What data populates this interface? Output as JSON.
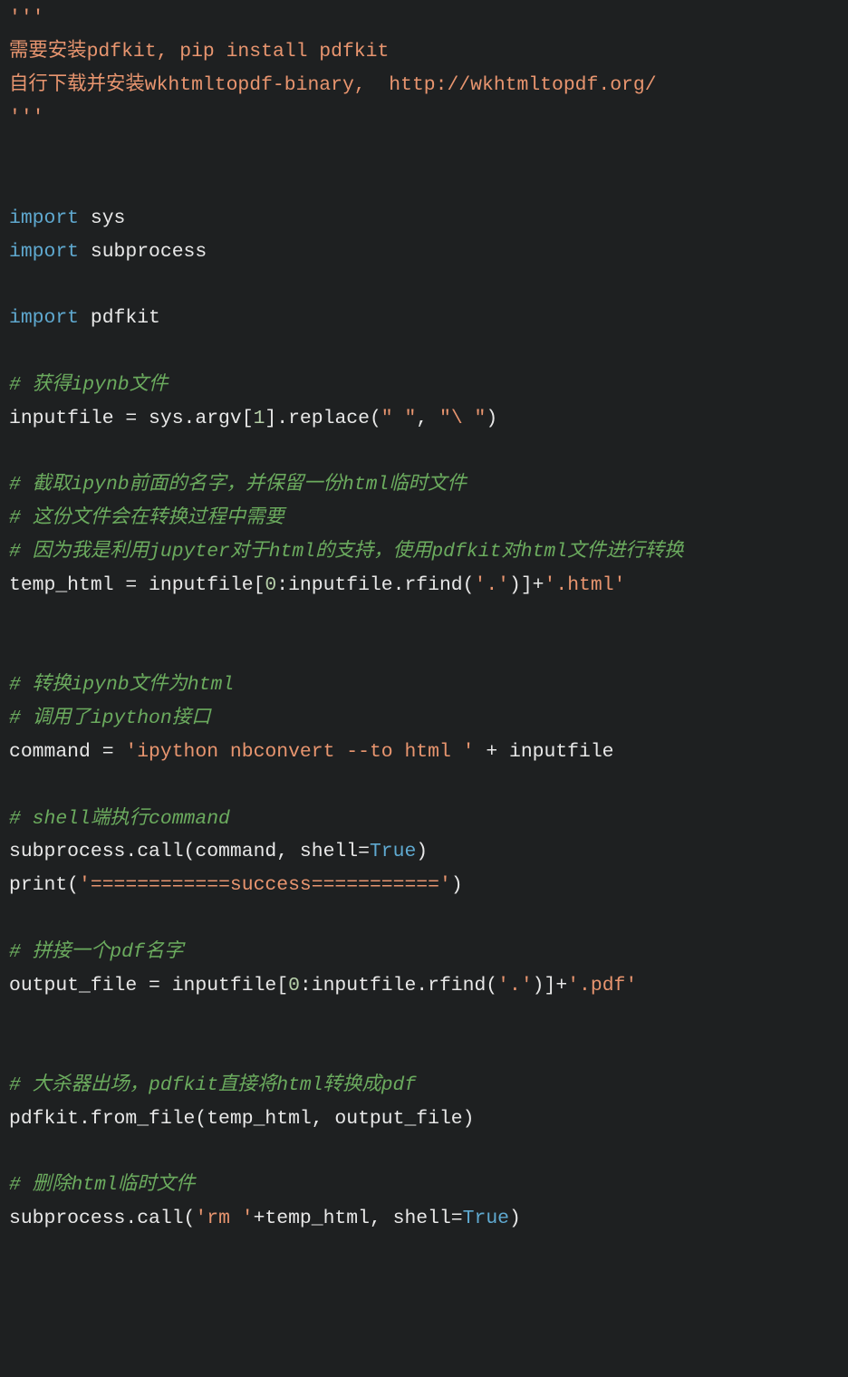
{
  "lines": [
    {
      "t0": "'''"
    },
    {
      "t0": "需要安装pdfkit, pip install pdfkit"
    },
    {
      "t0": "自行下载并安装wkhtmltopdf-binary,  http://wkhtmltopdf.org/"
    },
    {
      "t0": "'''"
    },
    {
      "t0": ""
    },
    {
      "t0": ""
    },
    {
      "t0": "import",
      "t1": " sys"
    },
    {
      "t0": "import",
      "t1": " subprocess"
    },
    {
      "t0": ""
    },
    {
      "t0": "import",
      "t1": " pdfkit"
    },
    {
      "t0": ""
    },
    {
      "t0": "# 获得ipynb文件"
    },
    {
      "t0": "inputfile = sys.argv[",
      "t1": "1",
      "t2": "].replace(",
      "t3": "\" \"",
      "t4": ", ",
      "t5": "\"\\ \"",
      "t6": ")"
    },
    {
      "t0": ""
    },
    {
      "t0": "# 截取ipynb前面的名字，并保留一份html临时文件"
    },
    {
      "t0": "# 这份文件会在转换过程中需要"
    },
    {
      "t0": "# 因为我是利用jupyter对于html的支持，使用pdfkit对html文件进行转换"
    },
    {
      "t0": "temp_html = inputfile[",
      "t1": "0",
      "t2": ":inputfile.rfind(",
      "t3": "'.'",
      "t4": ")]+",
      "t5": "'.html'"
    },
    {
      "t0": ""
    },
    {
      "t0": ""
    },
    {
      "t0": "# 转换ipynb文件为html"
    },
    {
      "t0": "# 调用了ipython接口"
    },
    {
      "t0": "command = ",
      "t1": "'ipython nbconvert --to html '",
      "t2": " + inputfile"
    },
    {
      "t0": ""
    },
    {
      "t0": "# shell端执行command"
    },
    {
      "t0": "subprocess.call(command, shell=",
      "t1": "True",
      "t2": ")"
    },
    {
      "t0": "print(",
      "t1": "'============success==========='",
      "t2": ")"
    },
    {
      "t0": ""
    },
    {
      "t0": "# 拼接一个pdf名字"
    },
    {
      "t0": "output_file = inputfile[",
      "t1": "0",
      "t2": ":inputfile.rfind(",
      "t3": "'.'",
      "t4": ")]+",
      "t5": "'.pdf'"
    },
    {
      "t0": ""
    },
    {
      "t0": ""
    },
    {
      "t0": "# 大杀器出场，pdfkit直接将html转换成pdf"
    },
    {
      "t0": "pdfkit.from_file(temp_html, output_file)"
    },
    {
      "t0": ""
    },
    {
      "t0": "# 删除html临时文件"
    },
    {
      "t0": "subprocess.call(",
      "t1": "'rm '",
      "t2": "+temp_html, shell=",
      "t3": "True",
      "t4": ")"
    }
  ]
}
